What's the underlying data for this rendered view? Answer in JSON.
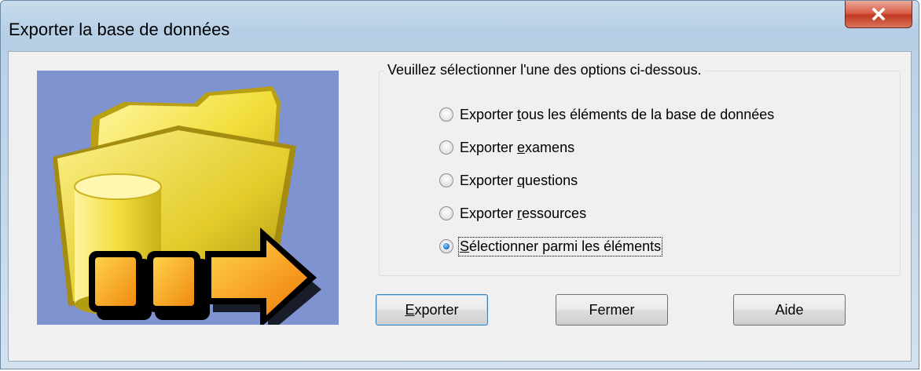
{
  "window": {
    "title": "Exporter la base de données",
    "close_glyph": "x"
  },
  "group": {
    "legend": "Veuillez sélectionner l'une des options ci-dessous.",
    "options": [
      {
        "pre": "Exporter ",
        "mnemonic": "t",
        "post": "ous les éléments de la base de données",
        "checked": false
      },
      {
        "pre": "Exporter ",
        "mnemonic": "e",
        "post": "xamens",
        "checked": false
      },
      {
        "pre": "Exporter ",
        "mnemonic": "q",
        "post": "uestions",
        "checked": false
      },
      {
        "pre": "Exporter ",
        "mnemonic": "r",
        "post": "essources",
        "checked": false
      },
      {
        "pre": "",
        "mnemonic": "S",
        "post": "électionner parmi les éléments",
        "checked": true
      }
    ]
  },
  "buttons": {
    "export": {
      "mnemonic": "E",
      "rest": "xporter"
    },
    "close": "Fermer",
    "help": "Aide"
  },
  "picture": {
    "icon": "folder-database-export-icon",
    "colors": {
      "background": "#7e93d0",
      "folder": "#f2e14a",
      "arrow": "#f7a21b"
    }
  }
}
